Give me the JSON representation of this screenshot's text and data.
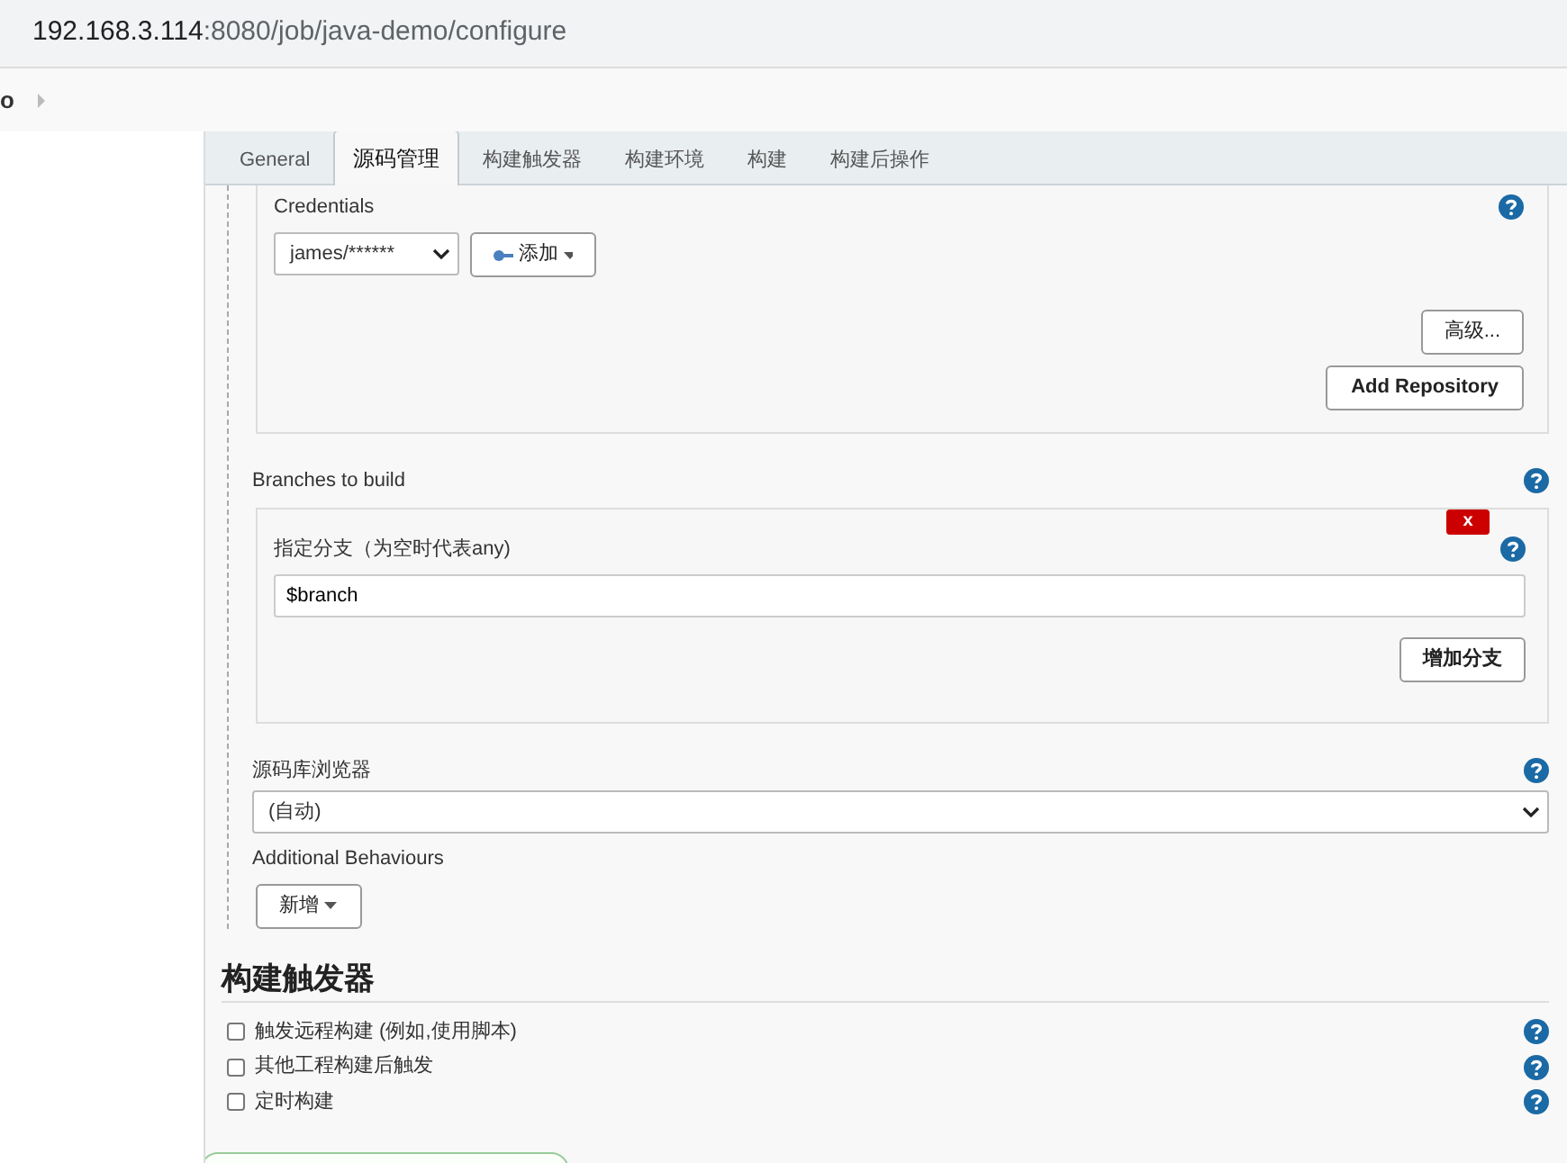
{
  "browser": {
    "address_host": "192.168.3.114",
    "address_path": ":8080/job/java-demo/configure"
  },
  "breadcrumb": {
    "item": "o"
  },
  "tabs": [
    {
      "label": "General",
      "selected": false
    },
    {
      "label": "源码管理",
      "selected": true
    },
    {
      "label": "构建触发器",
      "selected": false
    },
    {
      "label": "构建环境",
      "selected": false
    },
    {
      "label": "构建",
      "selected": false
    },
    {
      "label": "构建后操作",
      "selected": false
    }
  ],
  "scm": {
    "credentials": {
      "label": "Credentials",
      "value": "james/******",
      "add_button": "添加"
    },
    "advanced_button": "高级...",
    "add_repository_button": "Add Repository",
    "branches": {
      "label": "Branches to build",
      "branch_label": "指定分支（为空时代表any)",
      "value": "$branch",
      "delete_button": "x",
      "add_button": "增加分支"
    },
    "repo_browser": {
      "label": "源码库浏览器",
      "value": "(自动)"
    },
    "behaviours": {
      "label": "Additional Behaviours",
      "button": "新增"
    }
  },
  "triggers": {
    "heading": "构建触发器",
    "options": [
      {
        "label": "触发远程构建 (例如,使用脚本)",
        "checked": false
      },
      {
        "label": "其他工程构建后触发",
        "checked": false
      },
      {
        "label": "定时构建",
        "checked": false
      }
    ]
  }
}
